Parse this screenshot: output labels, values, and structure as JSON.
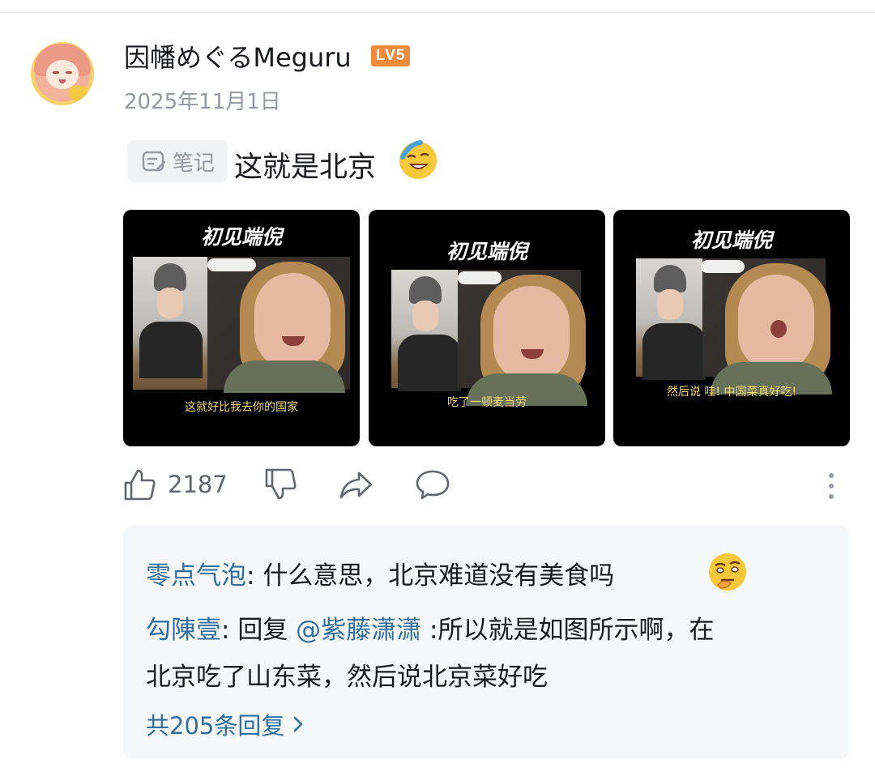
{
  "post": {
    "username": "因幡めぐるMeguru",
    "level": "LV5",
    "date": "2025年11月1日",
    "tag": "笔记",
    "text": "这就是北京"
  },
  "images": [
    {
      "title": "初见端倪",
      "caption": "这就好比我去你的国家"
    },
    {
      "title": "初见端倪",
      "caption": "吃了一顿麦当劳"
    },
    {
      "title": "初见端倪",
      "caption": "然后说 哇! 中国菜真好吃!"
    }
  ],
  "actions": {
    "like_count": "2187"
  },
  "replies": [
    {
      "user": "零点气泡",
      "sep": ": ",
      "text": "什么意思，北京难道没有美食吗"
    },
    {
      "user": "勾陳壹",
      "sep": ": ",
      "prefix": "回复 ",
      "at": "@紫藤潇潇",
      "text_line1": " :所以就是如图所示啊，在",
      "text_line2": "北京吃了山东菜，然后说北京菜好吃"
    }
  ],
  "more_replies": "共205条回复",
  "icons": [
    "note-icon",
    "laugh-cry-emoji-icon",
    "thumbs-up-icon",
    "thumbs-down-icon",
    "share-icon",
    "comment-icon",
    "more-icon",
    "thinking-emoji-icon",
    "chevron-right-icon"
  ],
  "colors": {
    "link": "#2f6e9e",
    "level_badge": "#f08a3c",
    "muted": "#9499a0",
    "caption": "#f2dc72"
  }
}
